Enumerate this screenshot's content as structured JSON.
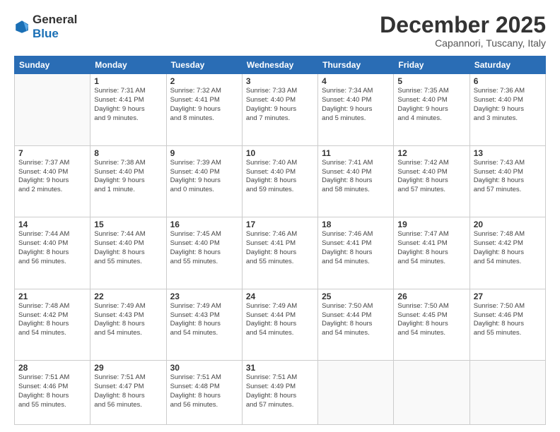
{
  "header": {
    "logo_line1": "General",
    "logo_line2": "Blue",
    "month": "December 2025",
    "location": "Capannori, Tuscany, Italy"
  },
  "weekdays": [
    "Sunday",
    "Monday",
    "Tuesday",
    "Wednesday",
    "Thursday",
    "Friday",
    "Saturday"
  ],
  "weeks": [
    [
      {
        "day": "",
        "info": ""
      },
      {
        "day": "1",
        "info": "Sunrise: 7:31 AM\nSunset: 4:41 PM\nDaylight: 9 hours\nand 9 minutes."
      },
      {
        "day": "2",
        "info": "Sunrise: 7:32 AM\nSunset: 4:41 PM\nDaylight: 9 hours\nand 8 minutes."
      },
      {
        "day": "3",
        "info": "Sunrise: 7:33 AM\nSunset: 4:40 PM\nDaylight: 9 hours\nand 7 minutes."
      },
      {
        "day": "4",
        "info": "Sunrise: 7:34 AM\nSunset: 4:40 PM\nDaylight: 9 hours\nand 5 minutes."
      },
      {
        "day": "5",
        "info": "Sunrise: 7:35 AM\nSunset: 4:40 PM\nDaylight: 9 hours\nand 4 minutes."
      },
      {
        "day": "6",
        "info": "Sunrise: 7:36 AM\nSunset: 4:40 PM\nDaylight: 9 hours\nand 3 minutes."
      }
    ],
    [
      {
        "day": "7",
        "info": "Sunrise: 7:37 AM\nSunset: 4:40 PM\nDaylight: 9 hours\nand 2 minutes."
      },
      {
        "day": "8",
        "info": "Sunrise: 7:38 AM\nSunset: 4:40 PM\nDaylight: 9 hours\nand 1 minute."
      },
      {
        "day": "9",
        "info": "Sunrise: 7:39 AM\nSunset: 4:40 PM\nDaylight: 9 hours\nand 0 minutes."
      },
      {
        "day": "10",
        "info": "Sunrise: 7:40 AM\nSunset: 4:40 PM\nDaylight: 8 hours\nand 59 minutes."
      },
      {
        "day": "11",
        "info": "Sunrise: 7:41 AM\nSunset: 4:40 PM\nDaylight: 8 hours\nand 58 minutes."
      },
      {
        "day": "12",
        "info": "Sunrise: 7:42 AM\nSunset: 4:40 PM\nDaylight: 8 hours\nand 57 minutes."
      },
      {
        "day": "13",
        "info": "Sunrise: 7:43 AM\nSunset: 4:40 PM\nDaylight: 8 hours\nand 57 minutes."
      }
    ],
    [
      {
        "day": "14",
        "info": "Sunrise: 7:44 AM\nSunset: 4:40 PM\nDaylight: 8 hours\nand 56 minutes."
      },
      {
        "day": "15",
        "info": "Sunrise: 7:44 AM\nSunset: 4:40 PM\nDaylight: 8 hours\nand 55 minutes."
      },
      {
        "day": "16",
        "info": "Sunrise: 7:45 AM\nSunset: 4:40 PM\nDaylight: 8 hours\nand 55 minutes."
      },
      {
        "day": "17",
        "info": "Sunrise: 7:46 AM\nSunset: 4:41 PM\nDaylight: 8 hours\nand 55 minutes."
      },
      {
        "day": "18",
        "info": "Sunrise: 7:46 AM\nSunset: 4:41 PM\nDaylight: 8 hours\nand 54 minutes."
      },
      {
        "day": "19",
        "info": "Sunrise: 7:47 AM\nSunset: 4:41 PM\nDaylight: 8 hours\nand 54 minutes."
      },
      {
        "day": "20",
        "info": "Sunrise: 7:48 AM\nSunset: 4:42 PM\nDaylight: 8 hours\nand 54 minutes."
      }
    ],
    [
      {
        "day": "21",
        "info": "Sunrise: 7:48 AM\nSunset: 4:42 PM\nDaylight: 8 hours\nand 54 minutes."
      },
      {
        "day": "22",
        "info": "Sunrise: 7:49 AM\nSunset: 4:43 PM\nDaylight: 8 hours\nand 54 minutes."
      },
      {
        "day": "23",
        "info": "Sunrise: 7:49 AM\nSunset: 4:43 PM\nDaylight: 8 hours\nand 54 minutes."
      },
      {
        "day": "24",
        "info": "Sunrise: 7:49 AM\nSunset: 4:44 PM\nDaylight: 8 hours\nand 54 minutes."
      },
      {
        "day": "25",
        "info": "Sunrise: 7:50 AM\nSunset: 4:44 PM\nDaylight: 8 hours\nand 54 minutes."
      },
      {
        "day": "26",
        "info": "Sunrise: 7:50 AM\nSunset: 4:45 PM\nDaylight: 8 hours\nand 54 minutes."
      },
      {
        "day": "27",
        "info": "Sunrise: 7:50 AM\nSunset: 4:46 PM\nDaylight: 8 hours\nand 55 minutes."
      }
    ],
    [
      {
        "day": "28",
        "info": "Sunrise: 7:51 AM\nSunset: 4:46 PM\nDaylight: 8 hours\nand 55 minutes."
      },
      {
        "day": "29",
        "info": "Sunrise: 7:51 AM\nSunset: 4:47 PM\nDaylight: 8 hours\nand 56 minutes."
      },
      {
        "day": "30",
        "info": "Sunrise: 7:51 AM\nSunset: 4:48 PM\nDaylight: 8 hours\nand 56 minutes."
      },
      {
        "day": "31",
        "info": "Sunrise: 7:51 AM\nSunset: 4:49 PM\nDaylight: 8 hours\nand 57 minutes."
      },
      {
        "day": "",
        "info": ""
      },
      {
        "day": "",
        "info": ""
      },
      {
        "day": "",
        "info": ""
      }
    ]
  ]
}
